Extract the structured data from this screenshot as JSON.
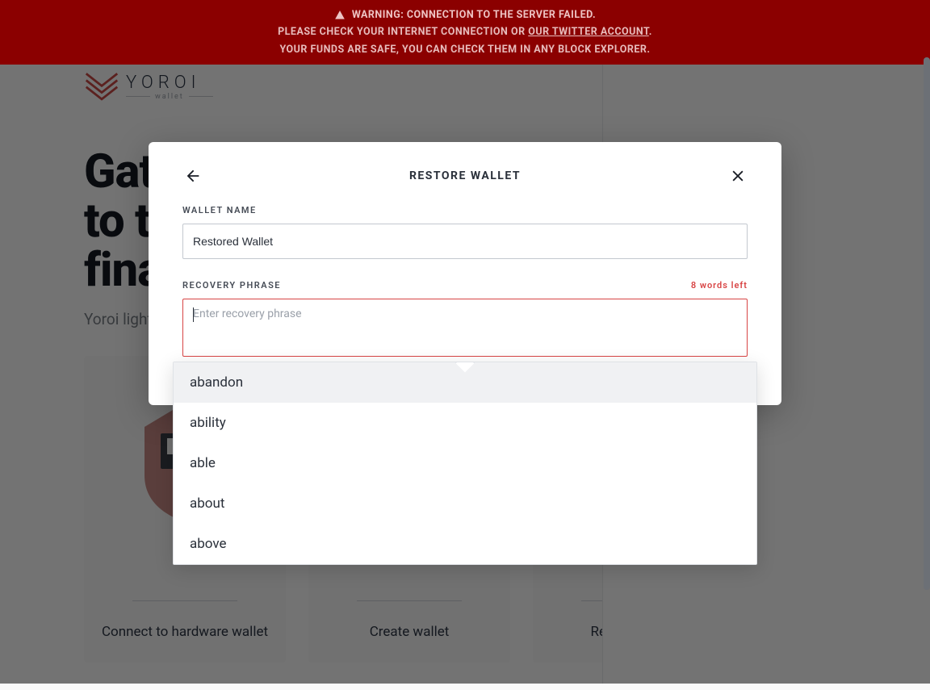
{
  "warning": {
    "line1": "WARNING: CONNECTION TO THE SERVER FAILED.",
    "line2a": "PLEASE CHECK YOUR INTERNET CONNECTION OR ",
    "twitter_link": "OUR TWITTER ACCOUNT",
    "line2b": ".",
    "line3": "YOUR FUNDS ARE SAFE, YOU CAN CHECK THEM IN ANY BLOCK EXPLORER."
  },
  "logo": {
    "brand": "YOROI",
    "suffix": "wallet"
  },
  "hero": {
    "title_line1": "Gateway",
    "title_line2": "to the",
    "title_line3": "financial world",
    "subtitle": "Yoroi light wallet for Cardano assets"
  },
  "cards": [
    {
      "label": "Connect to hardware wallet"
    },
    {
      "label": "Create wallet"
    },
    {
      "label": "Restore wallet"
    }
  ],
  "modal": {
    "title": "RESTORE WALLET",
    "wallet_name_label": "WALLET NAME",
    "wallet_name_value": "Restored Wallet",
    "recovery_label": "RECOVERY PHRASE",
    "words_left": "8 words left",
    "recovery_placeholder": "Enter recovery phrase"
  },
  "autocomplete": {
    "items": [
      "abandon",
      "ability",
      "able",
      "about",
      "above"
    ],
    "selected_index": 0
  }
}
